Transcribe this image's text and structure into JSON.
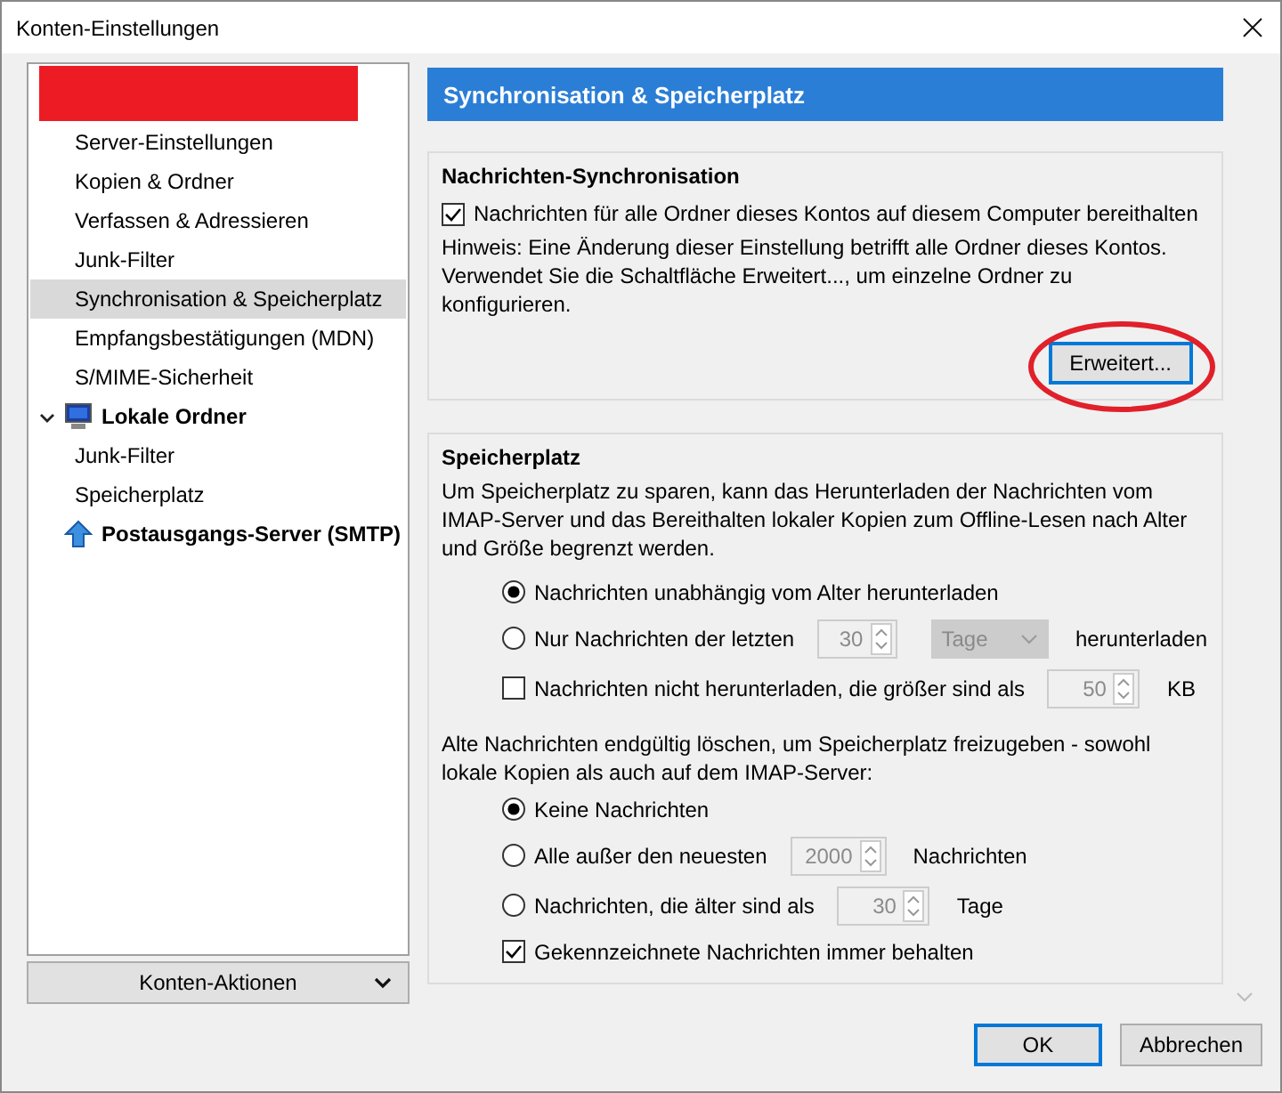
{
  "window": {
    "title": "Konten-Einstellungen"
  },
  "sidebar": {
    "accounts": [
      {
        "kind": "redacted",
        "children": [
          {
            "label": "Server-Einstellungen",
            "selected": false
          },
          {
            "label": "Kopien & Ordner",
            "selected": false
          },
          {
            "label": "Verfassen & Adressieren",
            "selected": false
          },
          {
            "label": "Junk-Filter",
            "selected": false
          },
          {
            "label": "Synchronisation & Speicherplatz",
            "selected": true
          },
          {
            "label": "Empfangsbestätigungen (MDN)",
            "selected": false
          },
          {
            "label": "S/MIME-Sicherheit",
            "selected": false
          }
        ]
      },
      {
        "kind": "local",
        "name": "Lokale Ordner",
        "expanded": true,
        "children": [
          {
            "label": "Junk-Filter",
            "selected": false
          },
          {
            "label": "Speicherplatz",
            "selected": false
          }
        ]
      },
      {
        "kind": "smtp",
        "name": "Postausgangs-Server (SMTP)"
      }
    ],
    "actions_button": "Konten-Aktionen"
  },
  "panel": {
    "title": "Synchronisation & Speicherplatz",
    "sync": {
      "heading": "Nachrichten-Synchronisation",
      "keep_checkbox": {
        "label": "Nachrichten für alle Ordner dieses Kontos auf diesem Computer bereithalten",
        "checked": true
      },
      "hint": "Hinweis: Eine Änderung dieser Einstellung betrifft alle Ordner dieses Kontos. Verwendet Sie die Schaltfläche Erweitert..., um einzelne Ordner zu konfigurieren.",
      "advanced_button": {
        "label": "Erweitert...",
        "highlighted": true
      }
    },
    "storage": {
      "heading": "Speicherplatz",
      "description": "Um Speicherplatz zu sparen, kann das Herunterladen der Nachrichten vom IMAP-Server und das Bereithalten lokaler Kopien zum Offline-Lesen nach Alter und Größe begrenzt werden.",
      "download_options": [
        {
          "kind": "radio",
          "label": "Nachrichten unabhängig vom Alter herunterladen",
          "selected": true
        },
        {
          "kind": "radio",
          "label": "Nur Nachrichten der letzten",
          "selected": false,
          "spin": {
            "value": "30",
            "disabled": true
          },
          "dropdown": {
            "value": "Tage",
            "disabled": true
          },
          "suffix": "herunterladen"
        },
        {
          "kind": "checkbox",
          "label": "Nachrichten nicht herunterladen, die größer sind als",
          "checked": false,
          "spin": {
            "value": "50",
            "disabled": true
          },
          "suffix": "KB"
        }
      ],
      "delete_description": "Alte Nachrichten endgültig löschen, um Speicherplatz freizugeben - sowohl lokale Kopien als auch auf dem IMAP-Server:",
      "delete_options": [
        {
          "kind": "radio",
          "label": "Keine Nachrichten",
          "selected": true
        },
        {
          "kind": "radio",
          "label": "Alle außer den neuesten",
          "selected": false,
          "spin": {
            "value": "2000",
            "disabled": true
          },
          "suffix": "Nachrichten"
        },
        {
          "kind": "radio",
          "label": "Nachrichten, die älter sind als",
          "selected": false,
          "spin": {
            "value": "30",
            "disabled": true
          },
          "suffix": "Tage"
        },
        {
          "kind": "checkbox",
          "label": "Gekennzeichnete Nachrichten immer behalten",
          "checked": true
        }
      ]
    }
  },
  "buttons": [
    {
      "label": "OK",
      "default": true
    },
    {
      "label": "Abbrechen",
      "default": false
    }
  ]
}
